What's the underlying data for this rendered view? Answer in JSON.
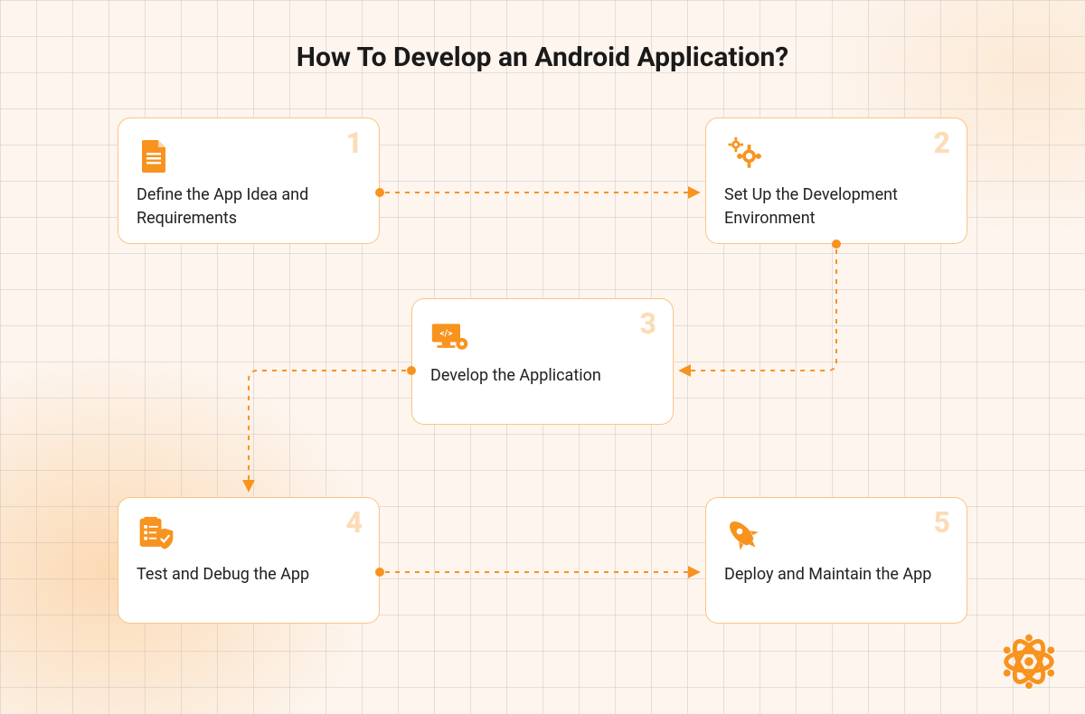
{
  "title": "How To Develop an Android Application?",
  "accent_color": "#F7931E",
  "steps": [
    {
      "num": "1",
      "icon": "document-icon",
      "label": "Define the App Idea and Requirements"
    },
    {
      "num": "2",
      "icon": "gears-icon",
      "label": "Set Up the Development Environment"
    },
    {
      "num": "3",
      "icon": "dev-screen-icon",
      "label": "Develop the Application"
    },
    {
      "num": "4",
      "icon": "test-shield-icon",
      "label": "Test and Debug the App"
    },
    {
      "num": "5",
      "icon": "rocket-icon",
      "label": "Deploy and Maintain the App"
    }
  ],
  "connections": [
    {
      "from": 1,
      "to": 2
    },
    {
      "from": 2,
      "to": 3
    },
    {
      "from": 3,
      "to": 4
    },
    {
      "from": 4,
      "to": 5
    }
  ]
}
